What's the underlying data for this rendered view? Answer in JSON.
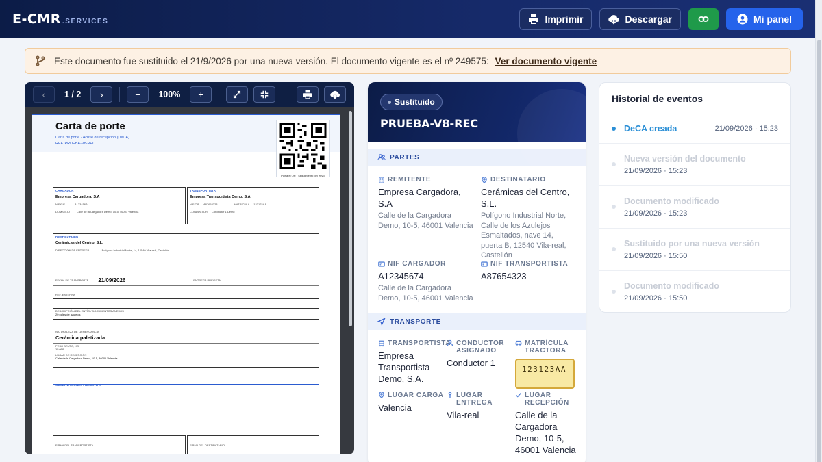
{
  "brand": {
    "main": "E-CMR",
    "sub": ".SERVICES"
  },
  "topbar": {
    "print_label": "Imprimir",
    "download_label": "Descargar",
    "panel_label": "Mi panel"
  },
  "banner": {
    "text": "Este documento fue sustituido el 21/9/2026 por una nueva versión. El documento vigente es el nº 249575:",
    "link": "Ver documento vigente"
  },
  "viewer": {
    "page": "1 / 2",
    "zoom": "100%",
    "minus": "−",
    "plus": "+"
  },
  "pdf": {
    "title": "Carta de porte",
    "subtitle": "Carta de porte · Acuse de recepción (DeCA)",
    "ref": "REF. PRUEBA-V8-REC",
    "qr_caption": "Pulsa el QR · Seguimiento del envío",
    "cargador_label": "CARGADOR",
    "cargador_name": "Empresa Cargadora, S.A",
    "cargador_nif_label": "NIF/CIF",
    "cargador_nif": "A12345674",
    "cargador_dom_label": "DOMICILIO",
    "cargador_dom": "Calle de la Cargadora Demo, 10-5, 46001 Valencia",
    "transportista_label": "TRANSPORTISTA",
    "transportista_name": "Empresa Transportista Demo, S.A.",
    "transportista_nif_label": "NIF/CIF",
    "transportista_nif": "A87654323",
    "matricula_label": "MATRÍCULA",
    "matricula_value": "123123AA",
    "conductor_label": "CONDUCTOR",
    "conductor_value": "Conductor 1 Demo",
    "destinatario_label": "DESTINATARIO",
    "destinatario_name": "Cerámicas del Centro, S.L.",
    "entrega_dir_label": "DIRECCIÓN DE ENTREGA",
    "entrega_dir": "Polígono Industrial Norte, 14, 12540 Vila-real, Castellón",
    "fecha_label": "FECHA DE TRANSPORTE",
    "fecha_value": "21/09/2026",
    "entrega_prev_label": "ENTREGA PREVISTA",
    "ref_ext_label": "REF. EXTERNA",
    "desc_label": "DESCRIPCIÓN DEL ENVÍO / DOCUMENTOS ANEXOS",
    "desc_value": "20 palés de azulejos",
    "naturaleza_label": "NATURALEZA DE LA MERCANCÍA",
    "naturaleza_value": "Cerámica paletizada",
    "peso_label": "PESO BRUTO, KG",
    "peso_value": "15.000",
    "lugar_rec_label": "LUGAR DE RECEPCIÓN",
    "lugar_rec_value": "Calle de la Cargadora Demo, 10-5, 46001 Valencia",
    "observ_label": "OBSERVACIONES / RESERVAS",
    "firma_trans_label": "FIRMA DEL TRANSPORTISTA",
    "firma_dest_label": "FIRMA DEL DESTINATARIO"
  },
  "detail": {
    "status": "Sustituido",
    "title": "PRUEBA-V8-REC",
    "partes_label": "PARTES",
    "remitente_label": "REMITENTE",
    "remitente_name": "Empresa Cargadora, S.A",
    "remitente_addr": "Calle de la Cargadora Demo, 10-5, 46001 Valencia",
    "destinatario_label": "DESTINATARIO",
    "destinatario_name": "Cerámicas del Centro, S.L.",
    "destinatario_addr": "Polígono Industrial Norte, Calle de los Azulejos Esmaltados, nave 14, puerta B, 12540 Vila-real, Castellón",
    "nif_cargador_label": "NIF CARGADOR",
    "nif_cargador": "A12345674",
    "nif_cargador_addr": "Calle de la Cargadora Demo, 10-5, 46001 Valencia",
    "nif_transportista_label": "NIF TRANSPORTISTA",
    "nif_transportista": "A87654323",
    "transporte_label": "TRANSPORTE",
    "transportista_label": "TRANSPORTISTA",
    "transportista_name": "Empresa Transportista Demo, S.A.",
    "conductor_label": "CONDUCTOR ASIGNADO",
    "conductor_name": "Conductor 1",
    "matricula_label": "MATRÍCULA TRACTORA",
    "matricula_value": "123123AA",
    "lugar_carga_label": "LUGAR CARGA",
    "lugar_carga": "Valencia",
    "lugar_entrega_label": "LUGAR ENTREGA",
    "lugar_entrega": "Vila-real",
    "lugar_recepcion_label": "LUGAR RECEPCIÓN",
    "lugar_recepcion": "Calle de la Cargadora Demo, 10-5, 46001 Valencia"
  },
  "history": {
    "title": "Historial de eventos",
    "events": [
      {
        "title": "DeCA creada",
        "date": "21/09/2026 · 15:23"
      },
      {
        "title": "Nueva versión del documento",
        "date": "21/09/2026 · 15:23"
      },
      {
        "title": "Documento modificado",
        "date": "21/09/2026 · 15:23"
      },
      {
        "title": "Sustituido por una nueva versión",
        "date": "21/09/2026 · 15:50"
      },
      {
        "title": "Documento modificado",
        "date": "21/09/2026 · 15:50"
      }
    ]
  }
}
